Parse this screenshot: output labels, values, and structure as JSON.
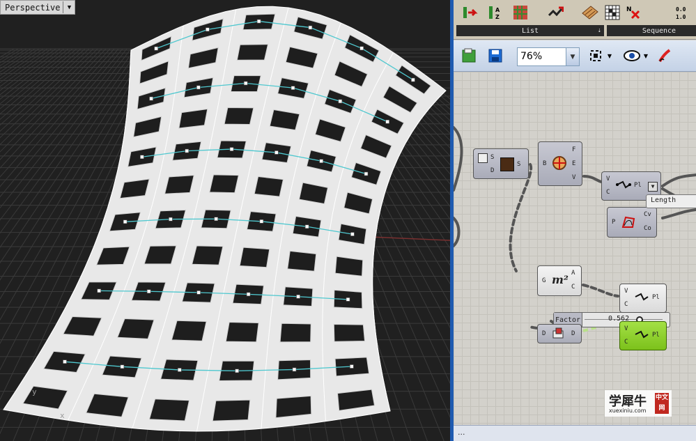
{
  "viewport": {
    "label": "Perspective",
    "axis_x": "x",
    "axis_y": "y"
  },
  "grasshopper": {
    "tabs": {
      "list": "List",
      "sequence": "Sequence"
    },
    "ribbon_icons": [
      "list-item-icon",
      "sort-list-icon",
      "sub-list-icon",
      "shift-list-icon",
      "weave-icon",
      "random-icon",
      "cull-nulls-icon",
      "series-icon"
    ],
    "toolbar": {
      "zoom": "76%"
    },
    "components": {
      "sort": {
        "in": [
          "S",
          "D"
        ],
        "out": [
          "S"
        ]
      },
      "deconstruct": {
        "in": [
          "B"
        ],
        "out": [
          "F",
          "E",
          "V"
        ]
      },
      "polyline_1": {
        "in": [
          "V",
          "C"
        ],
        "out": [
          "Pl"
        ]
      },
      "control_polygon": {
        "in": [
          "P"
        ],
        "out": [
          "Cv",
          "Co"
        ]
      },
      "area": {
        "label": "m²",
        "in": [
          "G"
        ],
        "out": [
          "A",
          "C"
        ]
      },
      "polyline_2": {
        "in": [
          "V",
          "C"
        ],
        "out": [
          "Pl"
        ]
      },
      "dispatch": {
        "in": [
          "D"
        ],
        "out": [
          "D"
        ]
      },
      "polyline_3": {
        "in": [
          "V",
          "C"
        ],
        "out": [
          "Pl"
        ]
      }
    },
    "slider": {
      "label": "Factor",
      "value": "0.562"
    },
    "dropdown": {
      "label": "Length"
    },
    "status": "..."
  },
  "watermark": {
    "brand": "学犀牛",
    "url": "xuexiniu.com",
    "seal": "中文网"
  }
}
